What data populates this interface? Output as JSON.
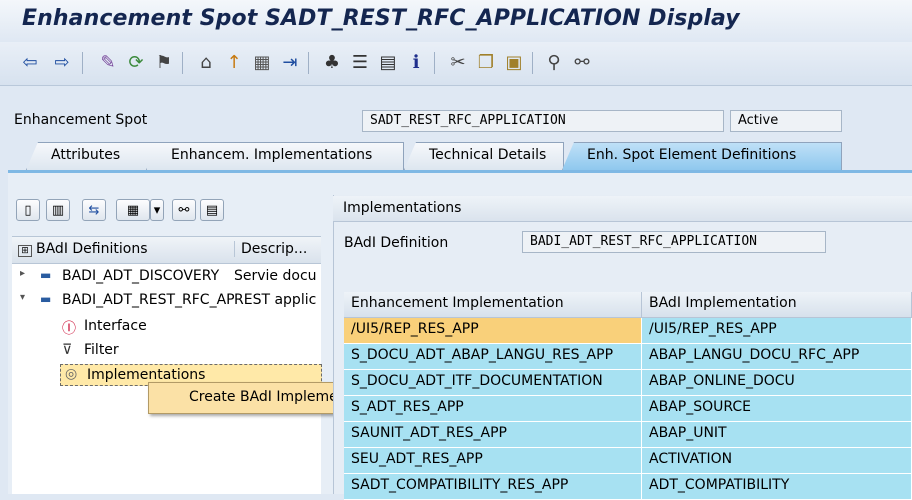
{
  "window": {
    "title": "Enhancement Spot SADT_REST_RFC_APPLICATION Display"
  },
  "toolbar": {
    "icons": [
      "back-arrow-icon",
      "forward-arrow-icon",
      "display-change-icon",
      "other-object-icon",
      "activate-icon",
      "where-used-icon",
      "object-list-icon",
      "navigation-window-icon",
      "enhancement-icon",
      "hierarchy-icon",
      "layout-icon",
      "documentation-icon",
      "info-icon",
      "cut-icon",
      "copy-icon",
      "paste-icon",
      "find-icon",
      "find-next-icon"
    ]
  },
  "header_form": {
    "spot_label": "Enhancement Spot",
    "spot_value": "SADT_REST_RFC_APPLICATION",
    "status": "Active"
  },
  "tabs": [
    {
      "label": "Attributes",
      "active": false
    },
    {
      "label": "Enhancem. Implementations",
      "active": false
    },
    {
      "label": "Technical Details",
      "active": false
    },
    {
      "label": "Enh. Spot Element Definitions",
      "active": true
    }
  ],
  "tree": {
    "col_definitions": "BAdI Definitions",
    "col_description": "Descrip...",
    "rows": [
      {
        "name": "BADI_ADT_DISCOVERY",
        "desc": "Servie docu"
      },
      {
        "name": "BADI_ADT_REST_RFC_APPLICATION",
        "desc": "REST applic"
      },
      {
        "name": "Interface",
        "desc": ""
      },
      {
        "name": "Filter",
        "desc": ""
      },
      {
        "name": "Implementations",
        "desc": ""
      }
    ]
  },
  "context_menu": {
    "item": "Create BAdI Implementation"
  },
  "implementations": {
    "panel_title": "Implementations",
    "badi_def_label": "BAdI Definition",
    "badi_def_value": "BADI_ADT_REST_RFC_APPLICATION",
    "columns": [
      "Enhancement Implementation",
      "BAdI Implementation"
    ],
    "rows": [
      {
        "enh": "/UI5/REP_RES_APP",
        "badi": "/UI5/REP_RES_APP",
        "highlight": true
      },
      {
        "enh": "S_DOCU_ADT_ABAP_LANGU_RES_APP",
        "badi": "ABAP_LANGU_DOCU_RFC_APP"
      },
      {
        "enh": "S_DOCU_ADT_ITF_DOCUMENTATION",
        "badi": "ABAP_ONLINE_DOCU"
      },
      {
        "enh": "S_ADT_RES_APP",
        "badi": "ABAP_SOURCE"
      },
      {
        "enh": "SAUNIT_ADT_RES_APP",
        "badi": "ABAP_UNIT"
      },
      {
        "enh": "SEU_ADT_RES_APP",
        "badi": "ACTIVATION"
      },
      {
        "enh": "SADT_COMPATIBILITY_RES_APP",
        "badi": "ADT_COMPATIBILITY"
      }
    ]
  },
  "colors": {
    "title": "#142650",
    "grid_row": "#a7e1f2",
    "grid_highlight": "#f9d07a",
    "context_menu": "#fbe1a6"
  }
}
